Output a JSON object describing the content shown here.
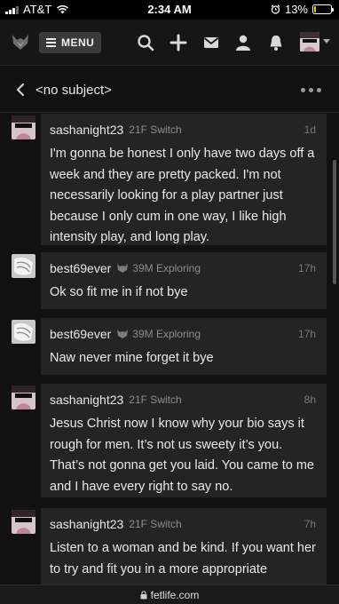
{
  "status_bar": {
    "carrier": "AT&T",
    "time": "2:34 AM",
    "battery_percent": "13%",
    "battery_level": 0.13
  },
  "nav": {
    "menu_label": "MENU",
    "icons": [
      "fetlife-logo-icon",
      "search-icon",
      "plus-icon",
      "mail-icon",
      "person-icon",
      "bell-icon"
    ]
  },
  "conversation": {
    "subject": "<no subject>"
  },
  "messages": [
    {
      "username": "sashanight23",
      "stats": "21F Switch",
      "time": "1d",
      "verified_icon": false,
      "text": "I'm gonna be honest I only have two days off a week and they are pretty packed. I'm not necessarily looking for a play partner just because I only cum in one way, I like high intensity play, and long play."
    },
    {
      "username": "best69ever",
      "stats": "39M Exploring",
      "time": "17h",
      "verified_icon": true,
      "text": "Ok so fit me in if not bye"
    },
    {
      "username": "best69ever",
      "stats": "39M Exploring",
      "time": "17h",
      "verified_icon": true,
      "text": "Naw never mine forget it bye"
    },
    {
      "username": "sashanight23",
      "stats": "21F Switch",
      "time": "8h",
      "verified_icon": false,
      "text": "Jesus Christ now I know why your bio says it rough for men. It’s not us sweety it’s you. That’s not gonna get you laid. You came to me and I have every right to say no."
    },
    {
      "username": "sashanight23",
      "stats": "21F Switch",
      "time": "7h",
      "verified_icon": false,
      "text": "Listen to a woman and be kind. If you want her to try and fit you in a more appropriate"
    }
  ],
  "url_bar": {
    "domain": "fetlife.com"
  },
  "colors": {
    "background": "#111111",
    "bubble": "#242424",
    "muted_text": "#8d8d8d",
    "battery": "#f5c400"
  }
}
